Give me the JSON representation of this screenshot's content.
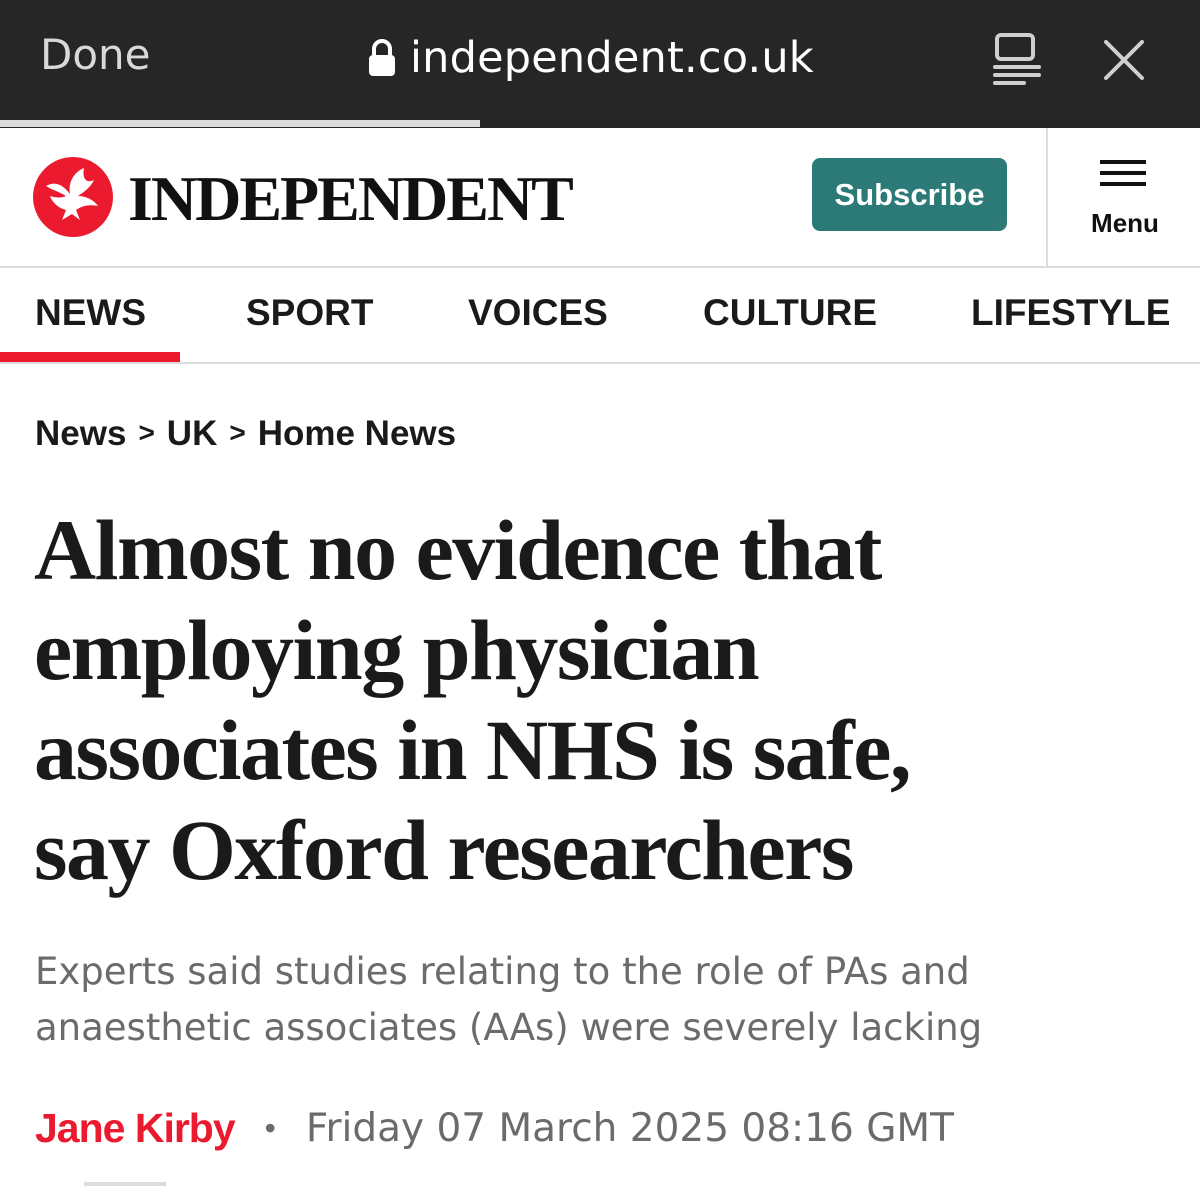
{
  "browser": {
    "done_label": "Done",
    "url": "independent.co.uk",
    "icons": [
      "lock-icon",
      "reader-icon",
      "close-icon"
    ],
    "load_progress": 0.4
  },
  "header": {
    "logo_text": "INDEPENDENT",
    "logo_icon": "eagle-icon",
    "subscribe_label": "Subscribe",
    "menu_label": "Menu",
    "colors": {
      "brand_red": "#ec1a2e",
      "subscribe_teal": "#2b7a78"
    }
  },
  "nav": {
    "items": [
      "NEWS",
      "SPORT",
      "VOICES",
      "CULTURE",
      "LIFESTYLE"
    ],
    "active": "NEWS"
  },
  "article": {
    "breadcrumb": [
      "News",
      "UK",
      "Home News"
    ],
    "breadcrumb_separator": ">",
    "headline_lines": [
      "Almost no evidence that",
      "employing physician",
      "associates in NHS is safe,",
      "say Oxford researchers"
    ],
    "standfirst_lines": [
      "Experts said studies relating to the role of PAs and",
      "anaesthetic associates (AAs) were severely lacking"
    ],
    "author": "Jane Kirby",
    "bullet": "•",
    "date": "Friday 07 March 2025 08:16 GMT"
  }
}
